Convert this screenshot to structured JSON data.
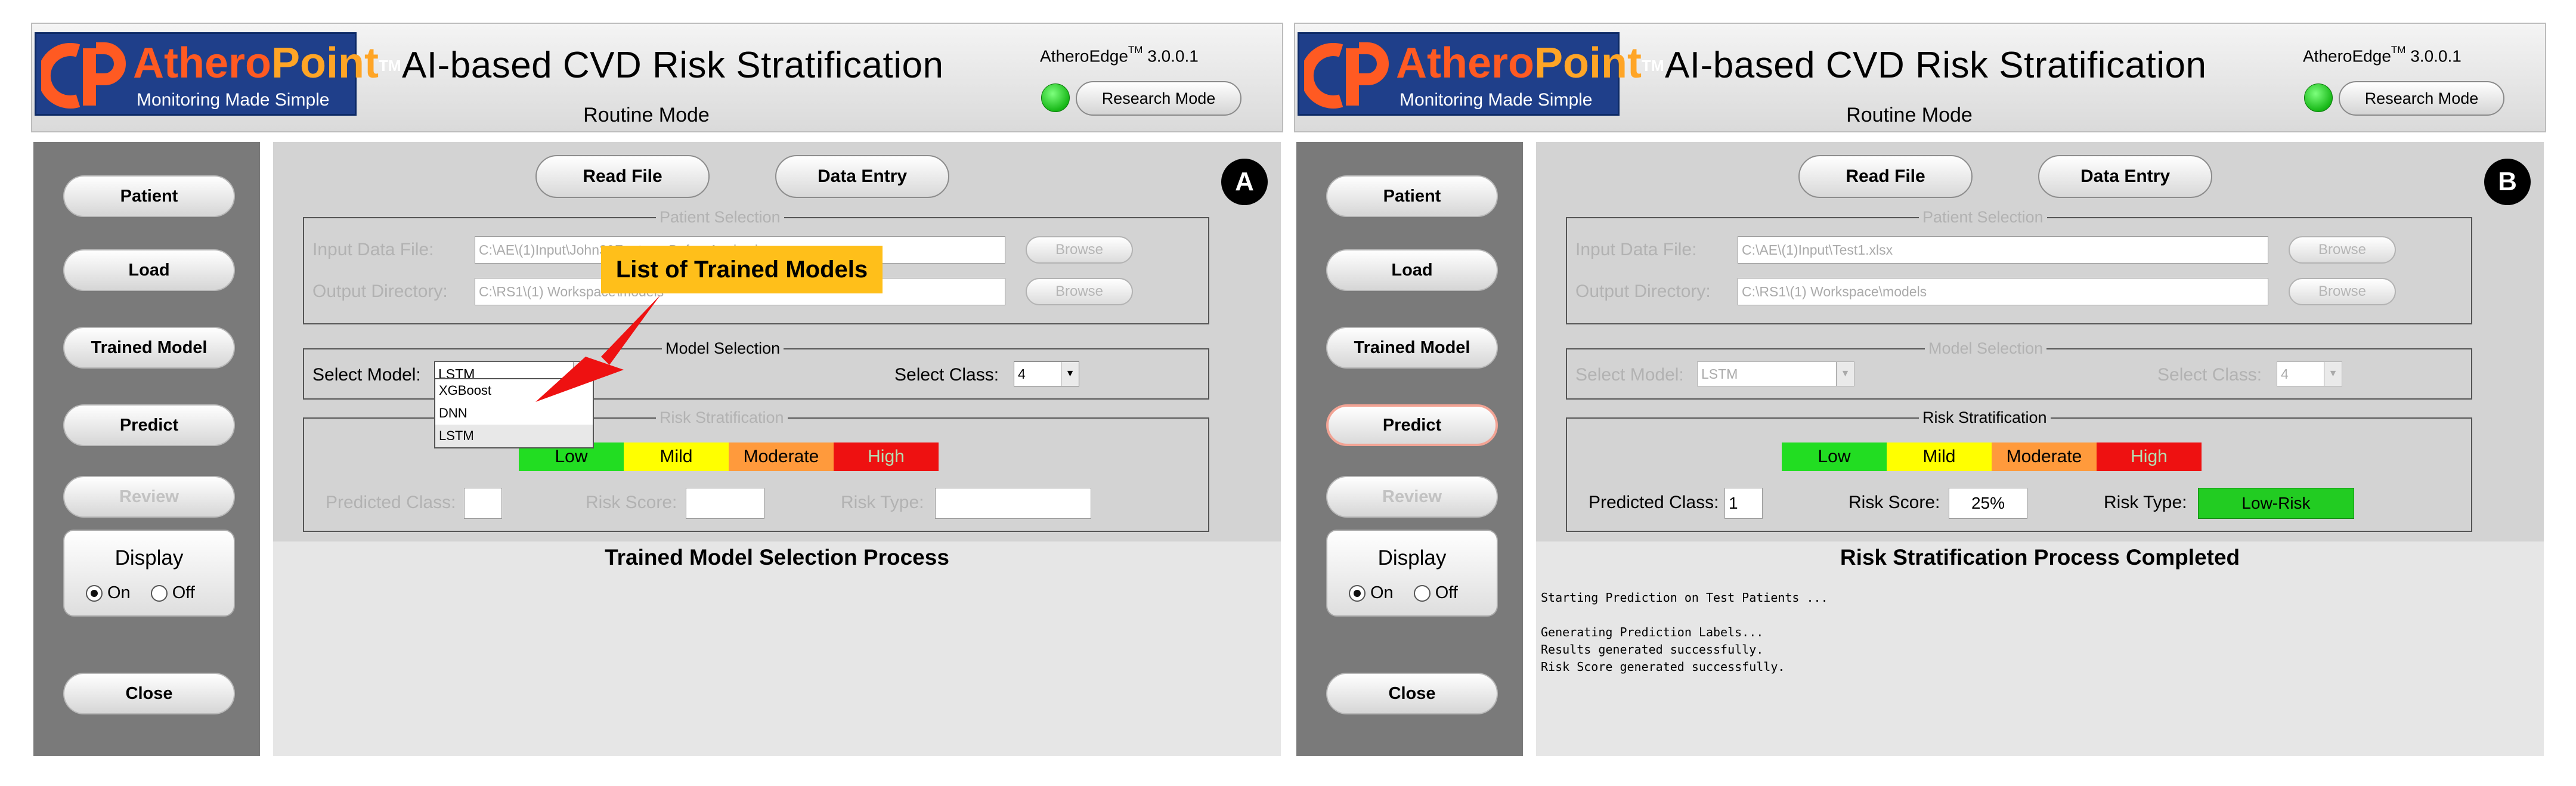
{
  "colors": {
    "accent_orange": "#ff5a22",
    "logo_bg": "#1f3f8a",
    "status_green": "#22c022",
    "risk_low": "#22dd22",
    "risk_mild": "#ffff00",
    "risk_moderate": "#ff9a3c",
    "risk_high": "#ee1111",
    "callout": "#ffbf1a"
  },
  "header": {
    "logo_part1": "Athero",
    "logo_part2": "Point",
    "logo_tm": "TM",
    "logo_tagline": "Monitoring Made Simple",
    "title": "AI-based CVD Risk Stratification",
    "mode": "Routine Mode",
    "version_name": "AtheroEdge",
    "version_tm": "TM",
    "version_number": "3.0.0.1",
    "research_mode_label": "Research Mode"
  },
  "sidebar": {
    "patient": "Patient",
    "load": "Load",
    "trained_model": "Trained Model",
    "predict": "Predict",
    "review": "Review",
    "display_title": "Display",
    "on": "On",
    "off": "Off",
    "close": "Close"
  },
  "toolbar": {
    "read_file": "Read File",
    "data_entry": "Data Entry"
  },
  "labels": {
    "patient_selection": "Patient Selection",
    "input_data_file": "Input Data File:",
    "output_directory": "Output Directory:",
    "browse": "Browse",
    "model_selection": "Model Selection",
    "select_model": "Select Model:",
    "select_class": "Select Class:",
    "risk_stratification": "Risk Stratification",
    "low": "Low",
    "mild": "Mild",
    "moderate": "Moderate",
    "high": "High",
    "predicted_class": "Predicted Class:",
    "risk_score": "Risk Score:",
    "risk_type": "Risk Type:"
  },
  "panel_a": {
    "tag": "A",
    "input_file": "C:\\AE\\(1)Input\\John39FeaturesBeforeAnglo.xlsx",
    "output_dir": "C:\\RS1\\(1) Workspace\\models",
    "model": "LSTM",
    "class_value": "4",
    "dropdown_options": [
      "XGBoost",
      "DNN",
      "LSTM"
    ],
    "callout": "List of Trained Models",
    "status_title": "Trained Model Selection Process"
  },
  "panel_b": {
    "tag": "B",
    "input_file": "C:\\AE\\(1)Input\\Test1.xlsx",
    "output_dir": "C:\\RS1\\(1) Workspace\\models",
    "model": "LSTM",
    "class_value": "4",
    "predicted_class": "1",
    "risk_score": "25%",
    "risk_type": "Low-Risk",
    "status_title": "Risk Stratification Process Completed",
    "log": [
      "Starting Prediction on Test Patients ...",
      "",
      "Generating Prediction Labels...",
      "Results generated successfully.",
      "Risk Score generated successfully."
    ]
  }
}
